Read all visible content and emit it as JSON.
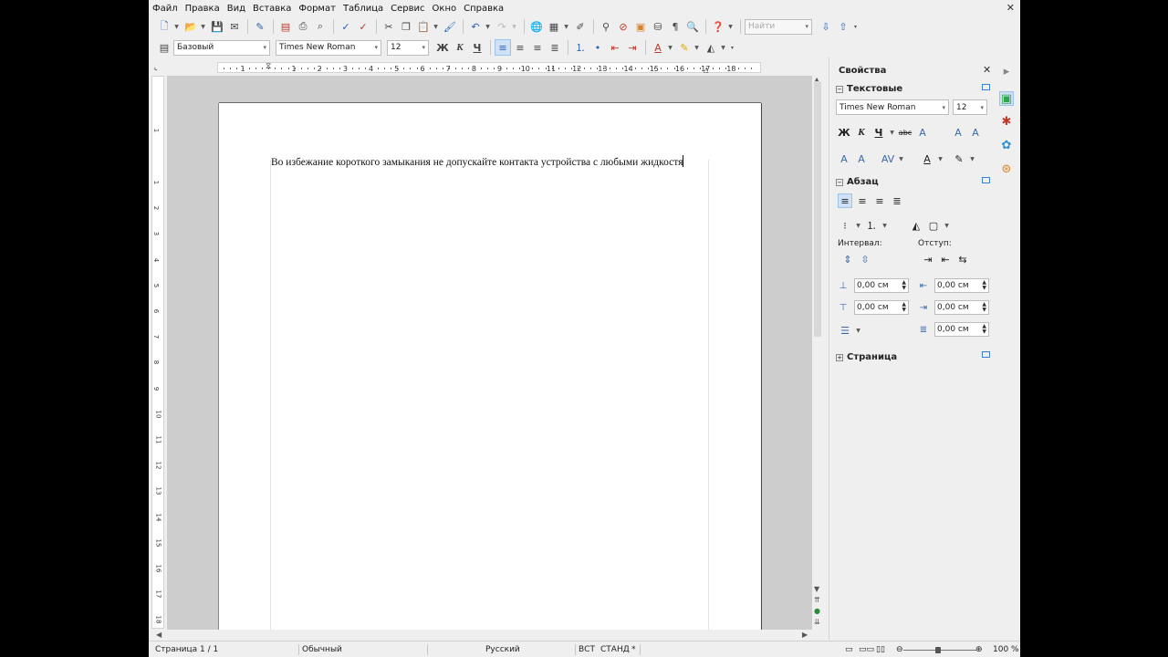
{
  "menu": [
    "Файл",
    "Правка",
    "Вид",
    "Вставка",
    "Формат",
    "Таблица",
    "Сервис",
    "Окно",
    "Справка"
  ],
  "toolbar": {
    "find_placeholder": "Найти",
    "paragraph_style": "Базовый",
    "font_name": "Times New Roman",
    "font_size": "12",
    "bold": "Ж",
    "italic": "К",
    "underline": "Ч"
  },
  "ruler": {
    "h_numbers": [
      "1",
      "1",
      "2",
      "3",
      "4",
      "5",
      "6",
      "7",
      "8",
      "9",
      "10",
      "11",
      "12",
      "13",
      "14",
      "15",
      "16",
      "17",
      "18"
    ],
    "v_numbers": [
      "1",
      "1",
      "2",
      "3",
      "4",
      "5",
      "6",
      "7",
      "8",
      "9",
      "10",
      "11",
      "12",
      "13",
      "14",
      "15",
      "16",
      "17",
      "18"
    ]
  },
  "document": {
    "text": "Во избежание короткого замыкания не допускайте контакта устройства с любыми жидкостя"
  },
  "sidebar": {
    "title": "Свойства",
    "text_section": {
      "title": "Текстовые",
      "font_name": "Times New Roman",
      "font_size": "12",
      "bold": "Ж",
      "italic": "К",
      "underline": "Ч"
    },
    "paragraph_section": {
      "title": "Абзац",
      "spacing_label": "Интервал:",
      "indent_label": "Отступ:",
      "above": "0,00 см",
      "below": "0,00 см",
      "before_text": "0,00 см",
      "after_text": "0,00 см",
      "first_line": "0,00 см"
    },
    "page_section": {
      "title": "Страница"
    }
  },
  "status": {
    "page": "Страница  1 / 1",
    "style": "Обычный",
    "language": "Русский",
    "insert_mode": "ВСТ",
    "selection_mode": "СТАНД",
    "zoom": "100 %"
  }
}
